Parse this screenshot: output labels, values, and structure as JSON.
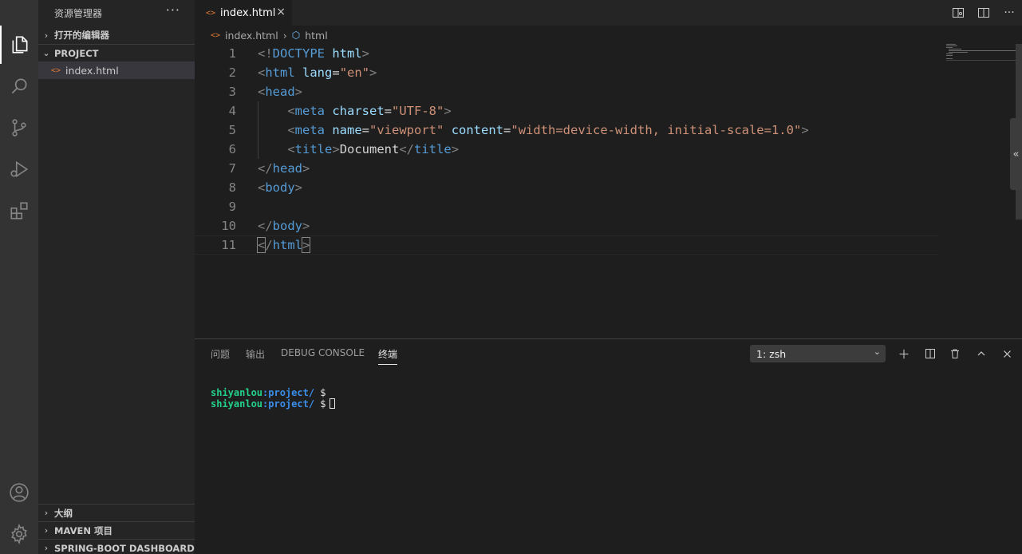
{
  "activity_bar": {
    "items": [
      {
        "name": "explorer-icon",
        "active": true
      },
      {
        "name": "search-icon",
        "active": false
      },
      {
        "name": "source-control-icon",
        "active": false
      },
      {
        "name": "run-debug-icon",
        "active": false
      },
      {
        "name": "extensions-icon",
        "active": false
      }
    ],
    "bottom": [
      "account-icon",
      "settings-gear-icon"
    ]
  },
  "sidebar": {
    "title": "资源管理器",
    "more": "···",
    "open_editors": "打开的编辑器",
    "project": "PROJECT",
    "files": [
      {
        "name": "index.html",
        "icon": "<>"
      }
    ],
    "outline": "大纲",
    "maven": "MAVEN 项目",
    "spring_boot": "SPRING-BOOT DASHBOARD"
  },
  "tab": {
    "label": "index.html",
    "icon": "<>",
    "close": "×"
  },
  "breadcrumb": {
    "file": "index.html",
    "icon": "<>",
    "symbol": "html"
  },
  "editor": {
    "lines": [
      {
        "n": "1",
        "tokens": [
          [
            "br",
            "<!"
          ],
          [
            "tag",
            "DOCTYPE"
          ],
          [
            "txt",
            " "
          ],
          [
            "attr",
            "html"
          ],
          [
            "br",
            ">"
          ]
        ]
      },
      {
        "n": "2",
        "tokens": [
          [
            "br",
            "<"
          ],
          [
            "tag",
            "html"
          ],
          [
            "txt",
            " "
          ],
          [
            "attr",
            "lang"
          ],
          [
            "eq",
            "="
          ],
          [
            "str",
            "\"en\""
          ],
          [
            "br",
            ">"
          ]
        ]
      },
      {
        "n": "3",
        "tokens": [
          [
            "br",
            "<"
          ],
          [
            "tag",
            "head"
          ],
          [
            "br",
            ">"
          ]
        ]
      },
      {
        "n": "4",
        "tokens": [
          [
            "txt",
            "    "
          ],
          [
            "br",
            "<"
          ],
          [
            "tag",
            "meta"
          ],
          [
            "txt",
            " "
          ],
          [
            "attr",
            "charset"
          ],
          [
            "eq",
            "="
          ],
          [
            "str",
            "\"UTF-8\""
          ],
          [
            "br",
            ">"
          ]
        ]
      },
      {
        "n": "5",
        "tokens": [
          [
            "txt",
            "    "
          ],
          [
            "br",
            "<"
          ],
          [
            "tag",
            "meta"
          ],
          [
            "txt",
            " "
          ],
          [
            "attr",
            "name"
          ],
          [
            "eq",
            "="
          ],
          [
            "str",
            "\"viewport\""
          ],
          [
            "txt",
            " "
          ],
          [
            "attr",
            "content"
          ],
          [
            "eq",
            "="
          ],
          [
            "str",
            "\"width=device-width, initial-scale=1.0\""
          ],
          [
            "br",
            ">"
          ]
        ]
      },
      {
        "n": "6",
        "tokens": [
          [
            "txt",
            "    "
          ],
          [
            "br",
            "<"
          ],
          [
            "tag",
            "title"
          ],
          [
            "br",
            ">"
          ],
          [
            "txt",
            "Document"
          ],
          [
            "br",
            "</"
          ],
          [
            "tag",
            "title"
          ],
          [
            "br",
            ">"
          ]
        ]
      },
      {
        "n": "7",
        "tokens": [
          [
            "br",
            "</"
          ],
          [
            "tag",
            "head"
          ],
          [
            "br",
            ">"
          ]
        ]
      },
      {
        "n": "8",
        "tokens": [
          [
            "br",
            "<"
          ],
          [
            "tag",
            "body"
          ],
          [
            "br",
            ">"
          ]
        ]
      },
      {
        "n": "9",
        "tokens": []
      },
      {
        "n": "10",
        "tokens": [
          [
            "br",
            "</"
          ],
          [
            "tag",
            "body"
          ],
          [
            "br",
            ">"
          ]
        ]
      },
      {
        "n": "11",
        "tokens": [
          [
            "hl",
            "<"
          ],
          [
            "br",
            "/"
          ],
          [
            "tag",
            "html"
          ],
          [
            "hl",
            ">"
          ]
        ]
      }
    ]
  },
  "panel": {
    "tabs": [
      {
        "label": "问题",
        "active": false
      },
      {
        "label": "输出",
        "active": false
      },
      {
        "label": "DEBUG CONSOLE",
        "active": false
      },
      {
        "label": "终端",
        "active": true
      }
    ],
    "terminal_select": "1: zsh",
    "terminal_lines": [
      {
        "user": "shiyanlou",
        "path": ":project/",
        "prompt": " $",
        "cursor": false
      },
      {
        "user": "shiyanlou",
        "path": ":project/",
        "prompt": " $",
        "cursor": true
      }
    ]
  },
  "colors": {
    "background": "#1e1e1e",
    "sidebar": "#252526",
    "activity_bar": "#333333",
    "accent_html_icon": "#e37933",
    "tag": "#569cd6",
    "attr": "#9cdcfe",
    "string": "#ce9178",
    "terminal_user": "#23d18b",
    "terminal_path": "#3b8eea"
  }
}
